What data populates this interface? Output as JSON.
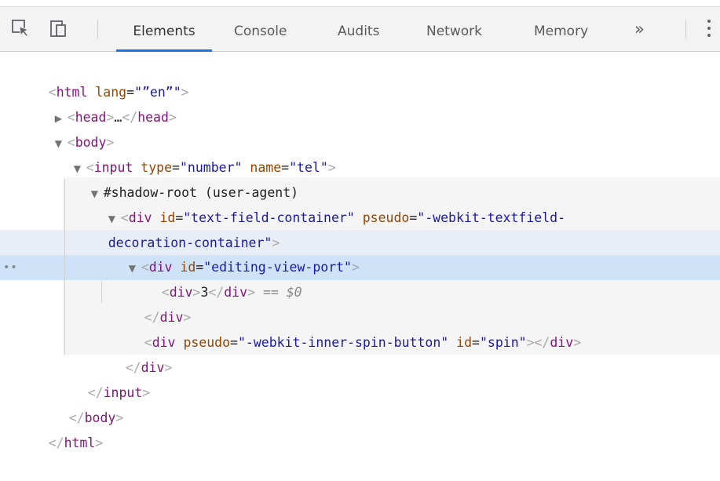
{
  "toolbar": {
    "icons": [
      "inspect-icon",
      "device-toolbar-icon",
      "more-tabs-icon",
      "kebab-menu-icon"
    ],
    "tabs": [
      {
        "label": "Elements",
        "active": true
      },
      {
        "label": "Console",
        "active": false
      },
      {
        "label": "Audits",
        "active": false
      },
      {
        "label": "Network",
        "active": false
      },
      {
        "label": "Memory",
        "active": false
      }
    ],
    "more_tabs_glyph": "»",
    "accent_color": "#1a73e8"
  },
  "dom": {
    "html_open": {
      "tag": "html",
      "attr_name": "lang",
      "attr_value": "\"”en”\""
    },
    "head": {
      "tag": "head",
      "ellipsis": "…"
    },
    "body_open": {
      "tag": "body"
    },
    "input_open": {
      "tag": "input",
      "attr1_name": "type",
      "attr1_value": "\"number\"",
      "attr2_name": "name",
      "attr2_value": "\"tel\""
    },
    "shadow_root": "#shadow-root (user-agent)",
    "container": {
      "tag": "div",
      "attr1_name": "id",
      "attr1_value": "\"text-field-container\"",
      "attr2_name": "pseudo",
      "attr2_value_part1": "\"-webkit-textfield-",
      "attr2_value_part2": "decoration-container\""
    },
    "viewport": {
      "tag": "div",
      "attr_name": "id",
      "attr_value": "\"editing-view-port\""
    },
    "inner": {
      "tag": "div",
      "text": "3",
      "selected_marker": "== $0"
    },
    "spin": {
      "tag": "div",
      "attr1_name": "pseudo",
      "attr1_value": "\"-webkit-inner-spin-button\"",
      "attr2_name": "id",
      "attr2_value": "\"spin\""
    },
    "closing_div": "div",
    "closing_input": "input",
    "closing_body": "body",
    "closing_html": "html",
    "gutter_dots": "••"
  },
  "colors": {
    "tag": "#881280",
    "attribute_name": "#994500",
    "attribute_value": "#1a1aa6",
    "selected_row": "#cfe3f8",
    "hover_row": "#e9edf5"
  }
}
